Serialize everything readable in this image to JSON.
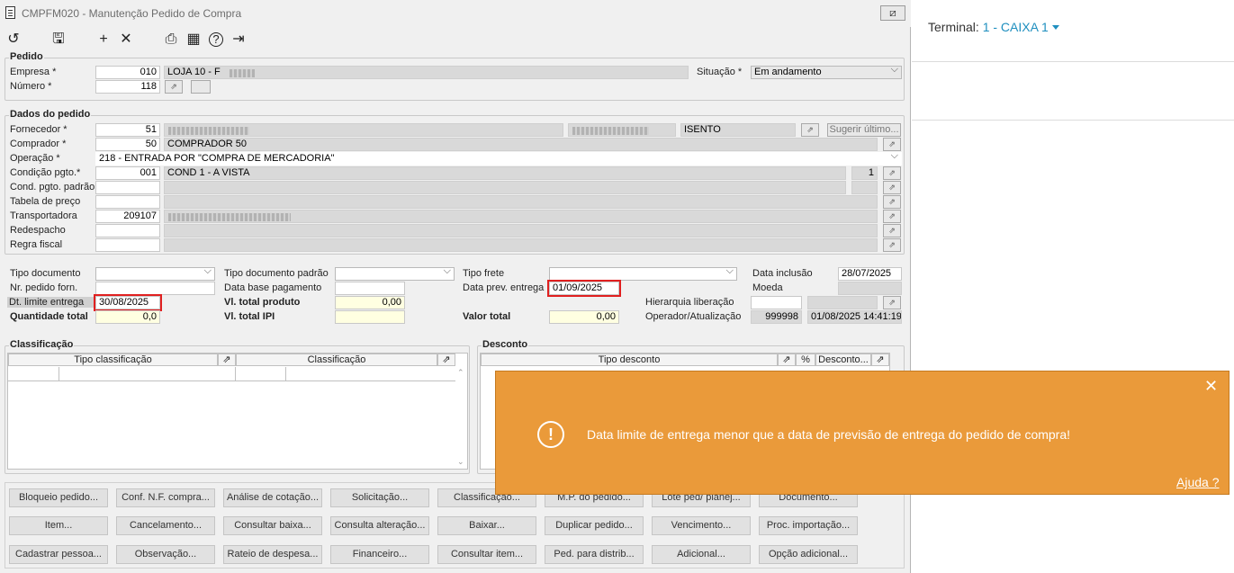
{
  "window": {
    "title": "CMPFM020 - Manutenção Pedido de Compra",
    "close_label": "⧄"
  },
  "toolbar": {
    "undo": "↺",
    "save": "🖫",
    "add": "+",
    "delete": "✕",
    "print": "⎙",
    "calendar": "▦",
    "help": "?",
    "exit": "⇥"
  },
  "pedido": {
    "title": "Pedido",
    "empresa_label": "Empresa *",
    "empresa_code": "010",
    "empresa_name": "LOJA 10 - F",
    "numero_label": "Número *",
    "numero_value": "118",
    "situacao_label": "Situação *",
    "situacao_value": "Em andamento"
  },
  "dados": {
    "title": "Dados do pedido",
    "fornecedor_label": "Fornecedor *",
    "fornecedor_code": "51",
    "isento": "ISENTO",
    "sugerir": "Sugerir último...",
    "comprador_label": "Comprador *",
    "comprador_code": "50",
    "comprador_name": "COMPRADOR 50",
    "operacao_label": "Operação *",
    "operacao_value": "218 - ENTRADA POR \"COMPRA DE MERCADORIA\"",
    "condicao_label": "Condição pgto.*",
    "condicao_code": "001",
    "condicao_name": "COND 1 - A VISTA",
    "condicao_n": "1",
    "cond_padrao_label": "Cond. pgto. padrão",
    "tabela_label": "Tabela de preço",
    "transportadora_label": "Transportadora",
    "transportadora_code": "209107",
    "redespacho_label": "Redespacho",
    "regra_label": "Regra fiscal"
  },
  "lower": {
    "tipo_doc_label": "Tipo documento",
    "nr_pedido_label": "Nr. pedido forn.",
    "dt_limite_label": "Dt. limite entrega",
    "dt_limite_value": "30/08/2025",
    "qtd_total_label": "Quantidade total",
    "qtd_total_value": "0,0",
    "tipo_doc_padrao_label": "Tipo documento padrão",
    "data_base_label": "Data base pagamento",
    "vl_total_prod_label": "Vl. total produto",
    "vl_total_prod_value": "0,00",
    "vl_total_ipi_label": "Vl. total IPI",
    "tipo_frete_label": "Tipo frete",
    "data_prev_label": "Data prev. entrega",
    "data_prev_value": "01/09/2025",
    "valor_total_label": "Valor total",
    "valor_total_value": "0,00",
    "data_inclusao_label": "Data inclusão",
    "data_inclusao_value": "28/07/2025",
    "moeda_label": "Moeda",
    "hierarquia_label": "Hierarquia liberação",
    "operador_label": "Operador/Atualização",
    "operador_value": "999998",
    "atualizacao_value": "01/08/2025 14:41:19"
  },
  "classificacao": {
    "title": "Classificação",
    "col1": "Tipo classificação",
    "col2": "Classificação"
  },
  "desconto": {
    "title": "Desconto",
    "col1": "Tipo desconto",
    "col2": "%",
    "col3": "Desconto..."
  },
  "buttons": {
    "row1": [
      "Bloqueio pedido...",
      "Conf. N.F. compra...",
      "Análise de cotação...",
      "Solicitação...",
      "Classificação...",
      "M.P. do pedido...",
      "Lote ped/ planej...",
      "Documento..."
    ],
    "row2": [
      "Item...",
      "Cancelamento...",
      "Consultar baixa...",
      "Consulta alteração...",
      "Baixar...",
      "Duplicar pedido...",
      "Vencimento...",
      "Proc. importação..."
    ],
    "row3": [
      "Cadastrar pessoa...",
      "Observação...",
      "Rateio de despesa...",
      "Financeiro...",
      "Consultar item...",
      "Ped. para distrib...",
      "Adicional...",
      "Opção adicional..."
    ]
  },
  "toast": {
    "message": "Data limite de entrega menor que a data de previsão de entrega do pedido de compra!",
    "help": "Ajuda ?",
    "close": "✕",
    "icon": "!",
    "color": "#EA9A3A"
  },
  "side": {
    "terminal_label": "Terminal:",
    "terminal_value": "1 - CAIXA 1"
  }
}
